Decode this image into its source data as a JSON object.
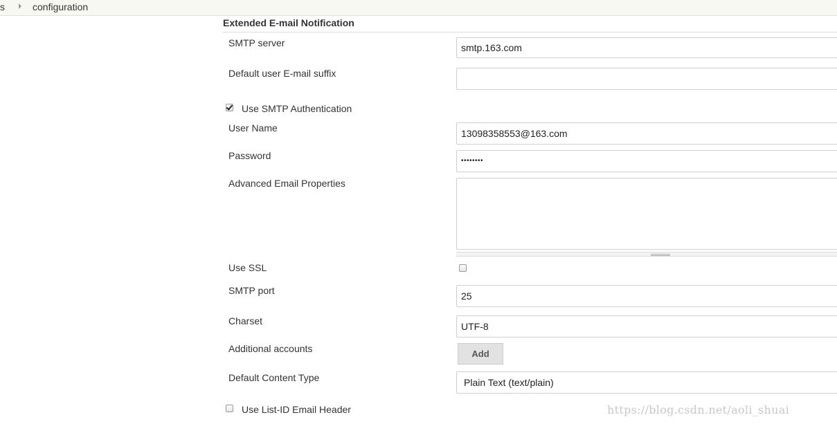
{
  "breadcrumb": {
    "previous": "s",
    "current": "configuration"
  },
  "section": {
    "title": "Extended E-mail Notification"
  },
  "form": {
    "smtp_server_label": "SMTP server",
    "smtp_server_value": "smtp.163.com",
    "email_suffix_label": "Default user E-mail suffix",
    "email_suffix_value": "",
    "use_smtp_auth_label": "Use SMTP Authentication",
    "use_smtp_auth_checked": true,
    "username_label": "User Name",
    "username_value": "13098358553@163.com",
    "password_label": "Password",
    "password_value": "••••••••",
    "advanced_props_label": "Advanced Email Properties",
    "advanced_props_value": "",
    "use_ssl_label": "Use SSL",
    "use_ssl_checked": false,
    "smtp_port_label": "SMTP port",
    "smtp_port_value": "25",
    "charset_label": "Charset",
    "charset_value": "UTF-8",
    "additional_accounts_label": "Additional accounts",
    "add_button_label": "Add",
    "content_type_label": "Default Content Type",
    "content_type_value": "Plain Text (text/plain)",
    "use_list_id_label": "Use List-ID Email Header",
    "use_list_id_checked": false
  },
  "watermark": "https://blog.csdn.net/aoli_shuai"
}
